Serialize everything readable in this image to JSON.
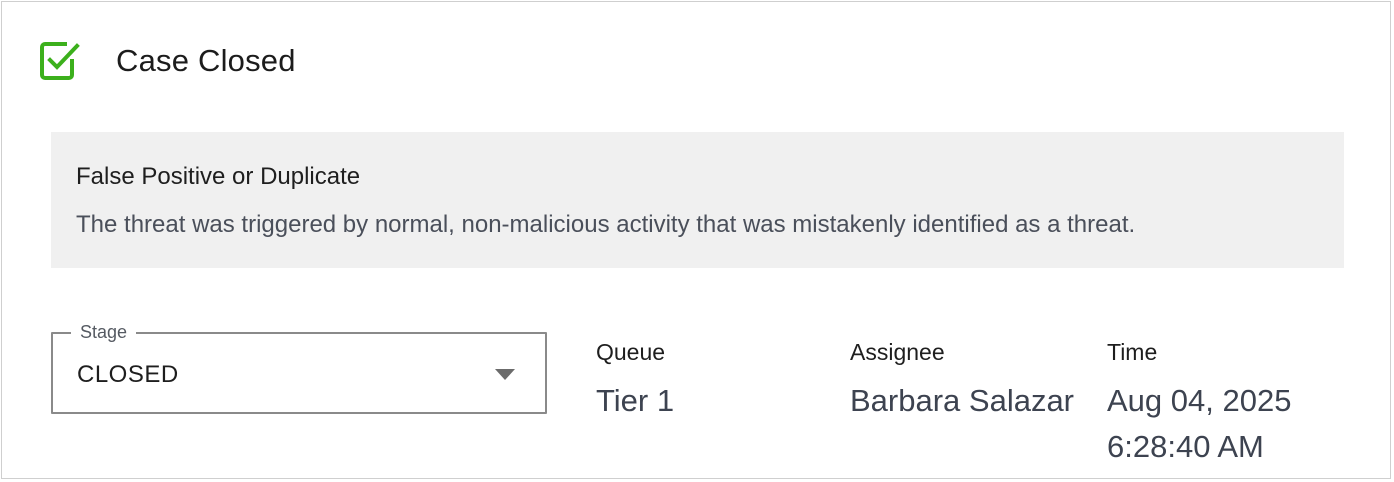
{
  "header": {
    "title": "Case Closed",
    "icon": "check-square-icon",
    "icon_color": "#3cb01c"
  },
  "reason": {
    "title": "False Positive or Duplicate",
    "description": "The threat was triggered by normal, non-malicious activity that was mistakenly identified as a threat."
  },
  "stage": {
    "label": "Stage",
    "value": "CLOSED",
    "icon": "chevron-down-icon"
  },
  "queue": {
    "label": "Queue",
    "value": "Tier 1"
  },
  "assignee": {
    "label": "Assignee",
    "value": "Barbara Salazar"
  },
  "time": {
    "label": "Time",
    "date": "Aug 04, 2025",
    "clock": "6:28:40 AM"
  }
}
